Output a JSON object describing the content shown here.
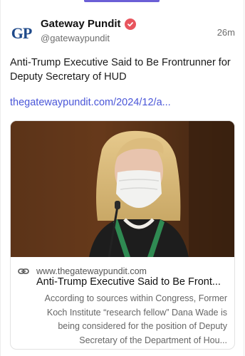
{
  "post": {
    "avatar_text": "GP",
    "display_name": "Gateway Pundit",
    "handle": "@gatewaypundit",
    "timestamp": "26m",
    "text": "Anti-Trump Executive Said to Be Frontrunner for Deputy Secretary of HUD",
    "link_text": "thegatewaypundit.com/2024/12/a...",
    "verified_icon": "verified-badge-icon"
  },
  "card": {
    "domain": "www.thegatewaypundit.com",
    "title": "Anti-Trump Executive Said to Be Front...",
    "description": "According to sources within Congress, Former Koch Institute “research fellow” Dana Wade is being considered for the position of Deputy Secretary of the Department of Hou...",
    "link_icon": "link-icon"
  },
  "colors": {
    "accent": "#6b5fd6",
    "link": "#4a56d8",
    "verified": "#e8555e",
    "brand": "#1f4a8a"
  }
}
